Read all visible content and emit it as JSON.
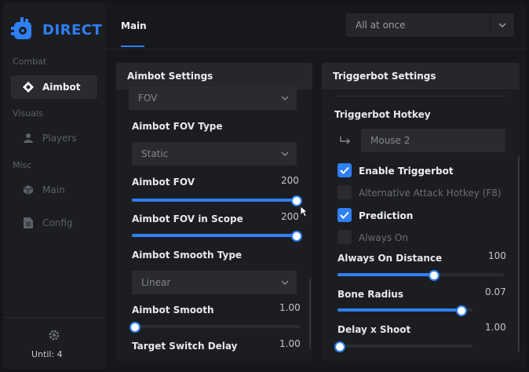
{
  "app": {
    "name": "DIRECT"
  },
  "sidebar": {
    "sections": [
      "Combat",
      "Visuals",
      "Misc"
    ],
    "items": [
      {
        "label": "Aimbot",
        "icon": "crosshair-icon",
        "active": true
      },
      {
        "label": "Players",
        "icon": "user-icon",
        "active": false
      },
      {
        "label": "Main",
        "icon": "cube-icon",
        "active": false
      },
      {
        "label": "Config",
        "icon": "file-icon",
        "active": false
      }
    ],
    "footer": {
      "until": "Until: 4",
      "icon": "gear-icon"
    }
  },
  "header": {
    "tab": "Main",
    "dropdown": {
      "value": "All at once"
    }
  },
  "aimbot": {
    "title": "Aimbot Settings",
    "fov_select": "FOV",
    "fov_type_label": "Aimbot FOV Type",
    "fov_type_value": "Static",
    "fov_label": "Aimbot FOV",
    "fov_value": "200",
    "fov_fraction": 1.0,
    "fov_scope_label": "Aimbot FOV in Scope",
    "fov_scope_value": "200",
    "fov_scope_fraction": 1.0,
    "smooth_type_label": "Aimbot Smooth Type",
    "smooth_type_value": "Linear",
    "smooth_label": "Aimbot Smooth",
    "smooth_value": "1.00",
    "smooth_fraction": 0.0,
    "switch_delay_label": "Target Switch Delay",
    "switch_delay_value": "1.00"
  },
  "triggerbot": {
    "title": "Triggerbot Settings",
    "hotkey_label": "Triggerbot Hotkey",
    "hotkey_value": "Mouse 2",
    "enable_label": "Enable Triggerbot",
    "enable_checked": true,
    "alt_label": "Alternative Attack Hotkey (F8)",
    "alt_checked": false,
    "prediction_label": "Prediction",
    "prediction_checked": true,
    "always_on_label": "Always On",
    "always_on_checked": false,
    "distance_label": "Always On Distance",
    "distance_value": "100",
    "distance_fraction": 0.58,
    "bone_label": "Bone Radius",
    "bone_value": "0.07",
    "bone_fraction": 0.92,
    "delay_label": "Delay x Shoot",
    "delay_value": "1.00",
    "delay_fraction": 0.02
  },
  "colors": {
    "accent": "#2f7ff5",
    "panel": "#1c1d21",
    "header": "#26272c"
  }
}
